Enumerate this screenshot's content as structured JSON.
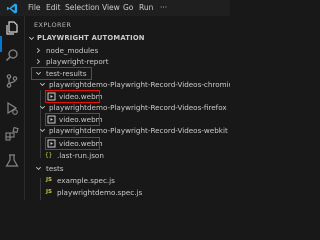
{
  "menubar": {
    "items": [
      "File",
      "Edit",
      "Selection",
      "View",
      "Go",
      "Run",
      "···"
    ]
  },
  "activitybar": {
    "icons": [
      "files-icon",
      "search-icon",
      "source-control-icon",
      "run-debug-icon",
      "extensions-icon",
      "testing-icon"
    ]
  },
  "sidebar": {
    "title": "EXPLORER",
    "section_title": "PLAYWRIGHT AUTOMATION",
    "tree": [
      {
        "label": "node_modules",
        "type": "folder",
        "expanded": false
      },
      {
        "label": "playwright-report",
        "type": "folder",
        "expanded": false
      },
      {
        "label": "test-results",
        "type": "folder",
        "expanded": true,
        "highlighted": true
      },
      {
        "label": "playwrightdemo-Playwright-Record-Videos-chromium",
        "type": "folder",
        "expanded": true
      },
      {
        "label": "video.webm",
        "type": "file",
        "highlighted": true
      },
      {
        "label": "playwrightdemo-Playwright-Record-Videos-firefox",
        "type": "folder",
        "expanded": true
      },
      {
        "label": "video.webm",
        "type": "file",
        "highlighted": true
      },
      {
        "label": "playwrightdemo-Playwright-Record-Videos-webkit",
        "type": "folder",
        "expanded": true
      },
      {
        "label": "video.webm",
        "type": "file",
        "highlighted": true
      },
      {
        "label": ".last-run.json",
        "type": "json"
      },
      {
        "label": "tests",
        "type": "folder",
        "expanded": true
      },
      {
        "label": "example.spec.js",
        "type": "js"
      },
      {
        "label": "playwrightdemo.spec.js",
        "type": "js"
      }
    ]
  },
  "colors": {
    "highlight": "#e51400",
    "accent": "#0078d4",
    "js_icon": "#cbcb41",
    "json_icon": "#cbcb41"
  }
}
